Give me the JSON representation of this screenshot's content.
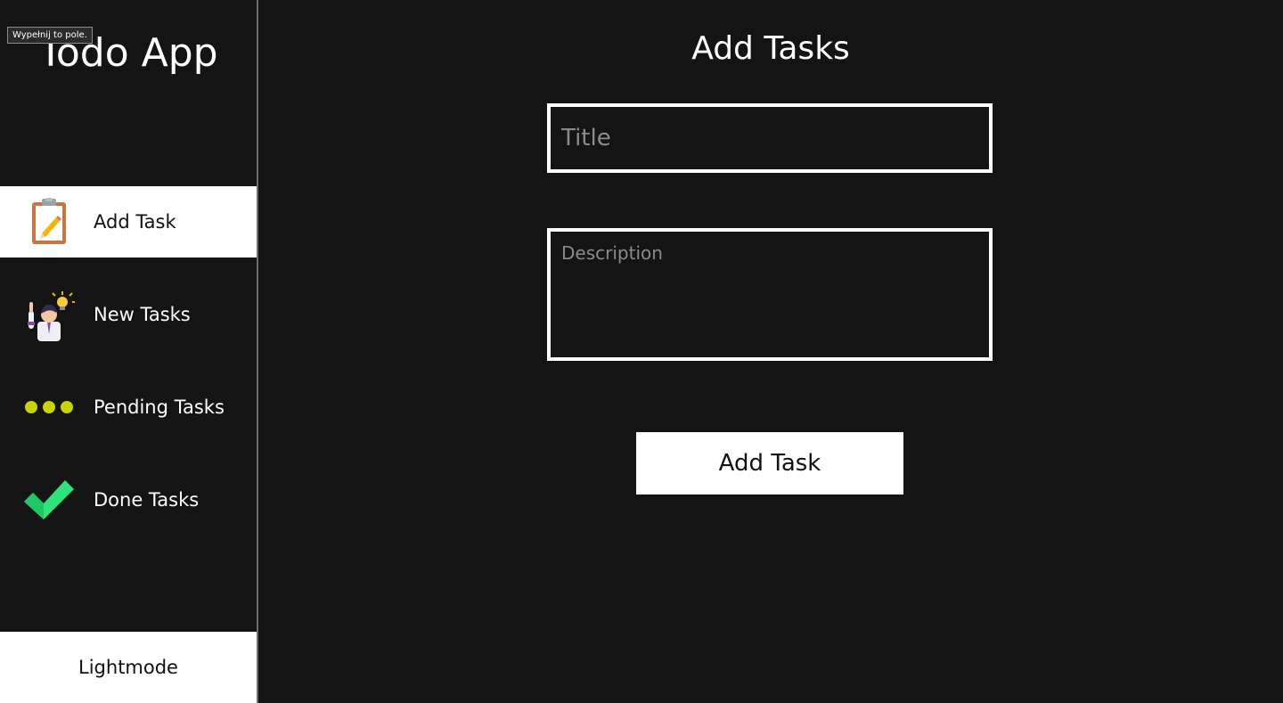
{
  "tooltip": "Wypełnij to pole.",
  "app_title": "Todo App",
  "sidebar": {
    "items": [
      {
        "label": "Add Task",
        "icon": "clipboard-pencil-icon",
        "active": true
      },
      {
        "label": "New Tasks",
        "icon": "person-idea-icon",
        "active": false
      },
      {
        "label": "Pending Tasks",
        "icon": "three-dots-icon",
        "active": false
      },
      {
        "label": "Done Tasks",
        "icon": "checkmark-icon",
        "active": false
      }
    ],
    "theme_toggle": "Lightmode"
  },
  "main": {
    "heading": "Add Tasks",
    "title_placeholder": "Title",
    "description_placeholder": "Description",
    "submit_label": "Add Task"
  },
  "colors": {
    "background": "#141414",
    "active_bg": "#ffffff",
    "pending_dots": "#c8d400",
    "done_check": "#2ee37a"
  }
}
